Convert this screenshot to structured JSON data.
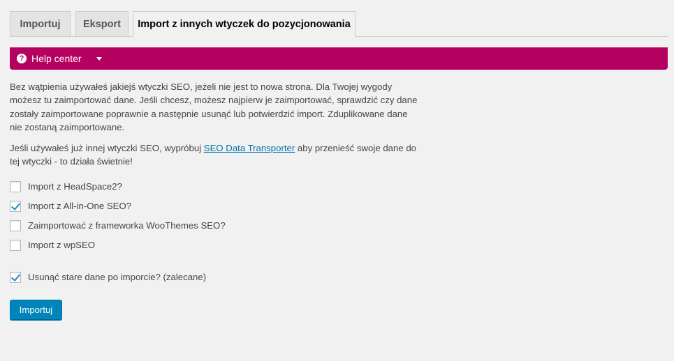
{
  "tabs": [
    {
      "label": "Importuj",
      "active": false
    },
    {
      "label": "Eksport",
      "active": false
    },
    {
      "label": "Import z innych wtyczek do pozycjonowania",
      "active": true
    }
  ],
  "help_center": {
    "icon": "question-icon",
    "icon_glyph": "?",
    "label": "Help center",
    "caret_icon": "caret-down-icon",
    "color": "#b4005f"
  },
  "intro": {
    "line1": "Bez wątpienia używałeś jakiejś wtyczki SEO, jeżeli nie jest to nowa strona. Dla Twojej wygody",
    "line2": "możesz tu zaimportować dane. Jeśli chcesz, możesz najpierw je zaimportować, sprawdzić czy dane",
    "line3": "zostały zaimportowane poprawnie a następnie usunąć lub potwierdzić import. Zduplikowane dane",
    "line4": "nie zostaną zaimportowane."
  },
  "transporter": {
    "before": "Jeśli używałeś już innej wtyczki SEO, wypróbuj ",
    "link_text": "SEO Data Transporter",
    "after_line1": " aby przenieść swoje dane do",
    "line2": "tej wtyczki - to działa świetnie!"
  },
  "options": [
    {
      "label": "Import z HeadSpace2?",
      "checked": false
    },
    {
      "label": "Import z All-in-One SEO?",
      "checked": true
    },
    {
      "label": "Zaimportować z frameworka WooThemes SEO?",
      "checked": false
    },
    {
      "label": "Import z wpSEO",
      "checked": false
    }
  ],
  "delete_old": {
    "label": "Usunąć stare dane po imporcie? (zalecane)",
    "checked": true
  },
  "submit": {
    "label": "Importuj",
    "color": "#0085ba"
  }
}
